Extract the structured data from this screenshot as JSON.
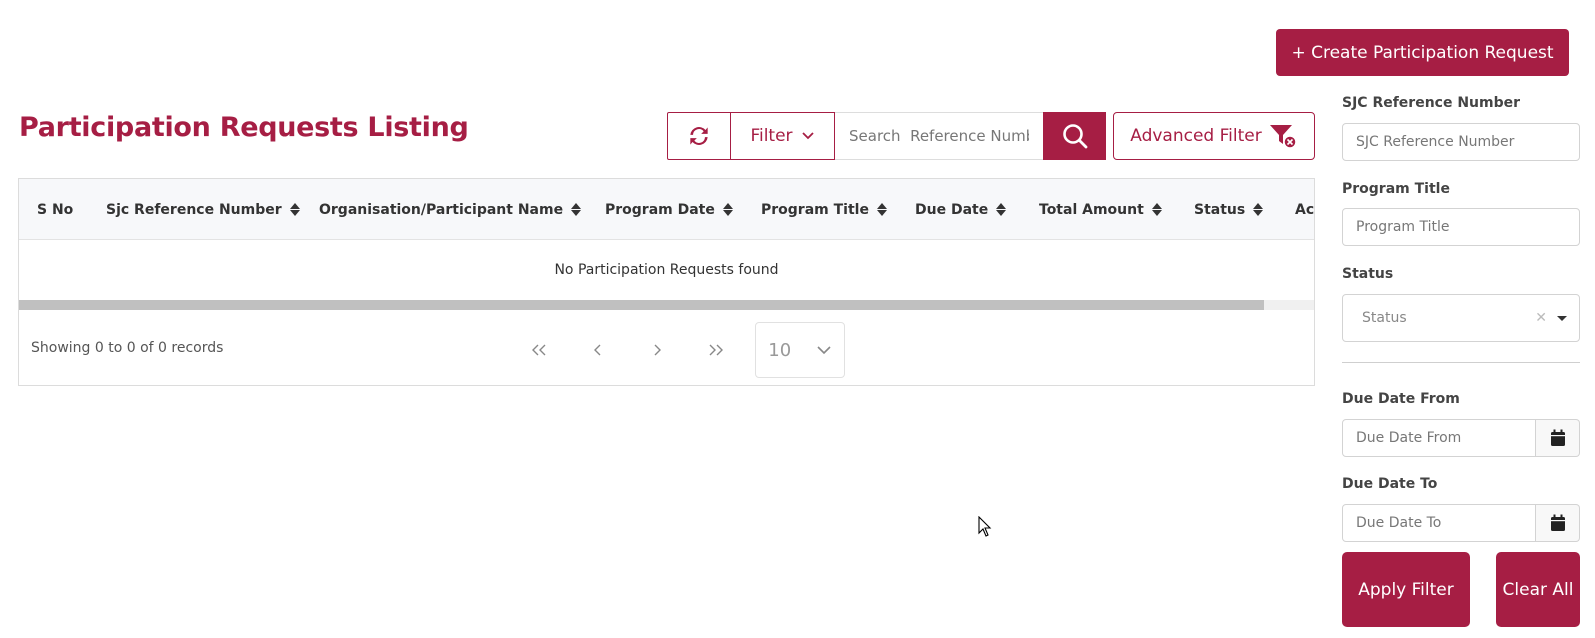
{
  "header": {
    "create_button": "+ Create Participation Request",
    "page_title": "Participation Requests Listing"
  },
  "toolbar": {
    "refresh_icon": "refresh-icon",
    "filter_label": "Filter",
    "search_placeholder": "Search  Reference Number",
    "search_icon": "search-icon",
    "advanced_filter_label": "Advanced Filter",
    "advanced_filter_icon": "filter-clear-icon"
  },
  "table": {
    "columns": [
      "S No",
      "Sjc Reference Number",
      "Organisation/Participant Name",
      "Program Date",
      "Program Title",
      "Due Date",
      "Total Amount",
      "Status",
      "Ac"
    ],
    "empty_message": "No Participation Requests found",
    "showing_text": "Showing 0 to 0 of 0 records",
    "page_size": "10"
  },
  "sidebar": {
    "sjc_label": "SJC Reference Number",
    "sjc_placeholder": "SJC Reference Number",
    "program_title_label": "Program Title",
    "program_title_placeholder": "Program Title",
    "status_label": "Status",
    "status_placeholder": "Status",
    "due_from_label": "Due Date From",
    "due_from_placeholder": "Due Date From",
    "due_to_label": "Due Date To",
    "due_to_placeholder": "Due Date To",
    "apply_label": "Apply Filter",
    "clear_label": "Clear All"
  },
  "colors": {
    "brand": "#a61e44"
  }
}
